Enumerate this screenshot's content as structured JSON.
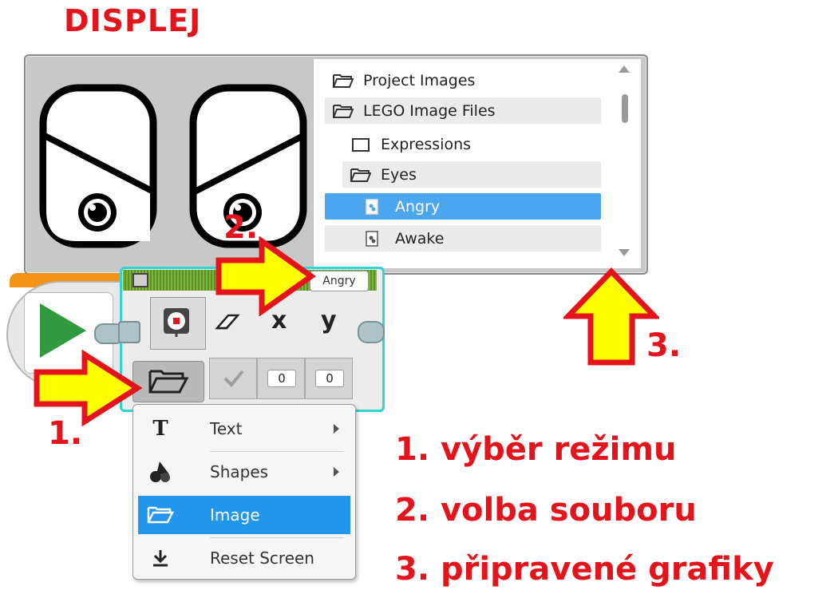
{
  "title": "DISPLEJ",
  "file_list": {
    "items": [
      {
        "label": "Project Images",
        "type": "folder-open",
        "indent": 0,
        "state": "normal"
      },
      {
        "label": "LEGO Image Files",
        "type": "folder-open",
        "indent": 0,
        "state": "shaded"
      },
      {
        "label": "Expressions",
        "type": "folder-closed",
        "indent": 1,
        "state": "normal"
      },
      {
        "label": "Eyes",
        "type": "folder-open",
        "indent": 1,
        "state": "shaded"
      },
      {
        "label": "Angry",
        "type": "image-file",
        "indent": 2,
        "state": "selected"
      },
      {
        "label": "Awake",
        "type": "image-file",
        "indent": 2,
        "state": "shaded"
      }
    ]
  },
  "display_block": {
    "filename": "Angry",
    "x_label": "x",
    "y_label": "y",
    "x_value": "0",
    "y_value": "0"
  },
  "menu": {
    "items": [
      {
        "label": "Text",
        "icon": "text-icon",
        "submenu": true
      },
      {
        "label": "Shapes",
        "icon": "shapes-icon",
        "submenu": true
      },
      {
        "label": "Image",
        "icon": "folder-icon",
        "submenu": false,
        "selected": true
      },
      {
        "label": "Reset Screen",
        "icon": "download-icon",
        "submenu": false
      }
    ]
  },
  "annotations": {
    "step1": "1.",
    "step2": "2.",
    "step3": "3.",
    "legend1": "1. výběr režimu",
    "legend2": "2. volba souboru",
    "legend3": "3. připravené grafiky"
  },
  "colors": {
    "annotation_red": "#e3141c",
    "arrow_yellow": "#ffff00",
    "selection_blue": "#4ba6ee",
    "block_border_cyan": "#2fd6d3",
    "header_green": "#6fa232"
  }
}
